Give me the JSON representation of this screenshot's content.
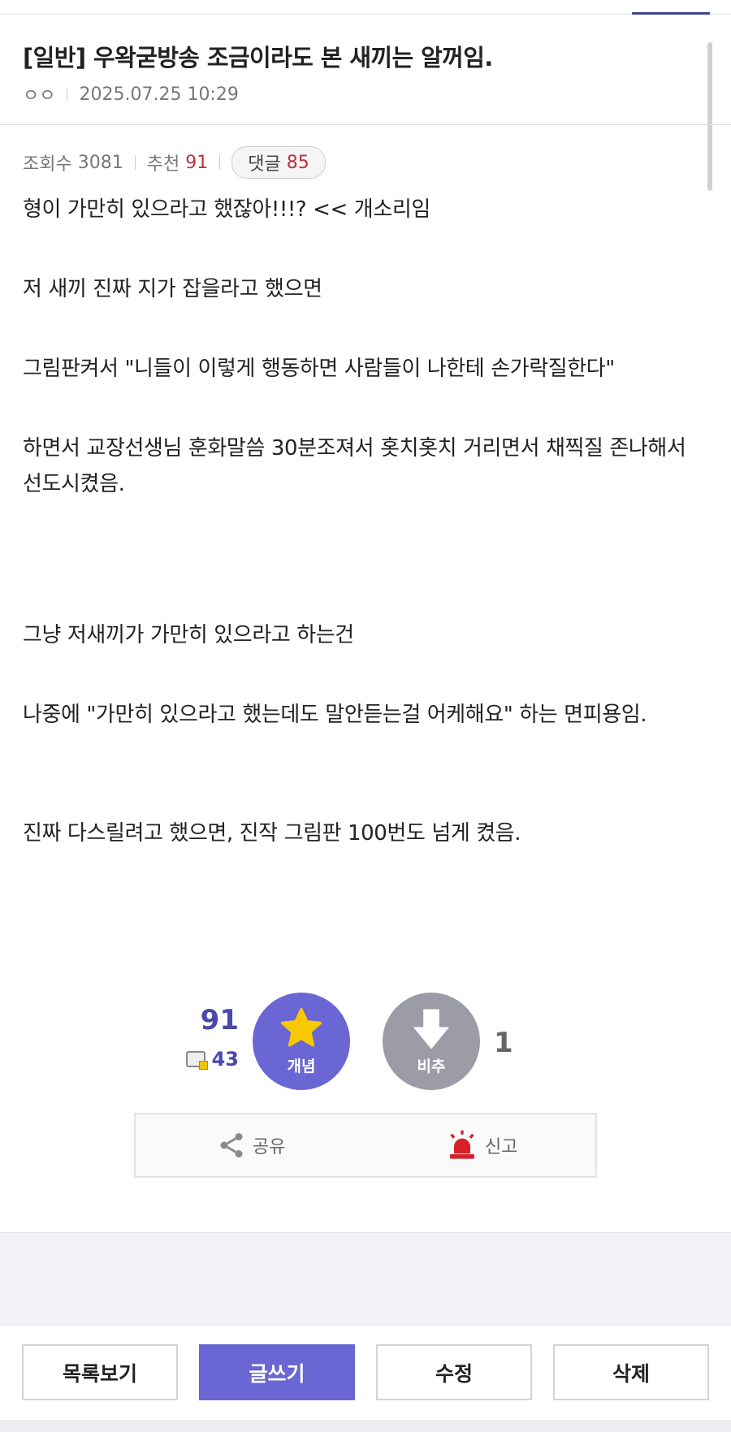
{
  "post": {
    "title": "[일반] 우왁굳방송 조금이라도 본 새끼는 알꺼임.",
    "author": "ㅇㅇ",
    "date": "2025.07.25 10:29"
  },
  "stats": {
    "views_label": "조회수",
    "views": "3081",
    "recommend_label": "추천",
    "recommend": "91",
    "comments_label": "댓글",
    "comments": "85"
  },
  "content": {
    "paragraphs": [
      "형이 가만히 있으라고 했잖아!!!? << 개소리임",
      "저 새끼 진짜 지가 잡을라고 했으면",
      "그림판켜서 \"니들이 이렇게 행동하면 사람들이 나한테 손가락질한다\"",
      "하면서 교장선생님 훈화말씀 30분조져서 홋치홋치 거리면서 채찍질 존나해서 선도시켰음.",
      "그냥 저새끼가 가만히 있으라고 하는건",
      "나중에 \"가만히 있으라고 했는데도 말안듣는걸 어케해요\" 하는 면피용임.",
      "진짜 다스릴려고 했으면, 진작 그림판 100번도 넘게 켰음."
    ]
  },
  "vote": {
    "up_count": "91",
    "fixed_count": "43",
    "up_label": "개념",
    "down_label": "비추",
    "down_count": "1",
    "up_color": "#6a66d4",
    "star_color": "#f8c900",
    "down_color": "#9c9ca6"
  },
  "actions": {
    "share": "공유",
    "report": "신고"
  },
  "bottom": {
    "list": "목록보기",
    "write": "글쓰기",
    "edit": "수정",
    "delete": "삭제"
  },
  "icons": [
    "share-icon",
    "siren-icon",
    "star-icon",
    "arrow-down-icon",
    "fixed-user-icon"
  ]
}
